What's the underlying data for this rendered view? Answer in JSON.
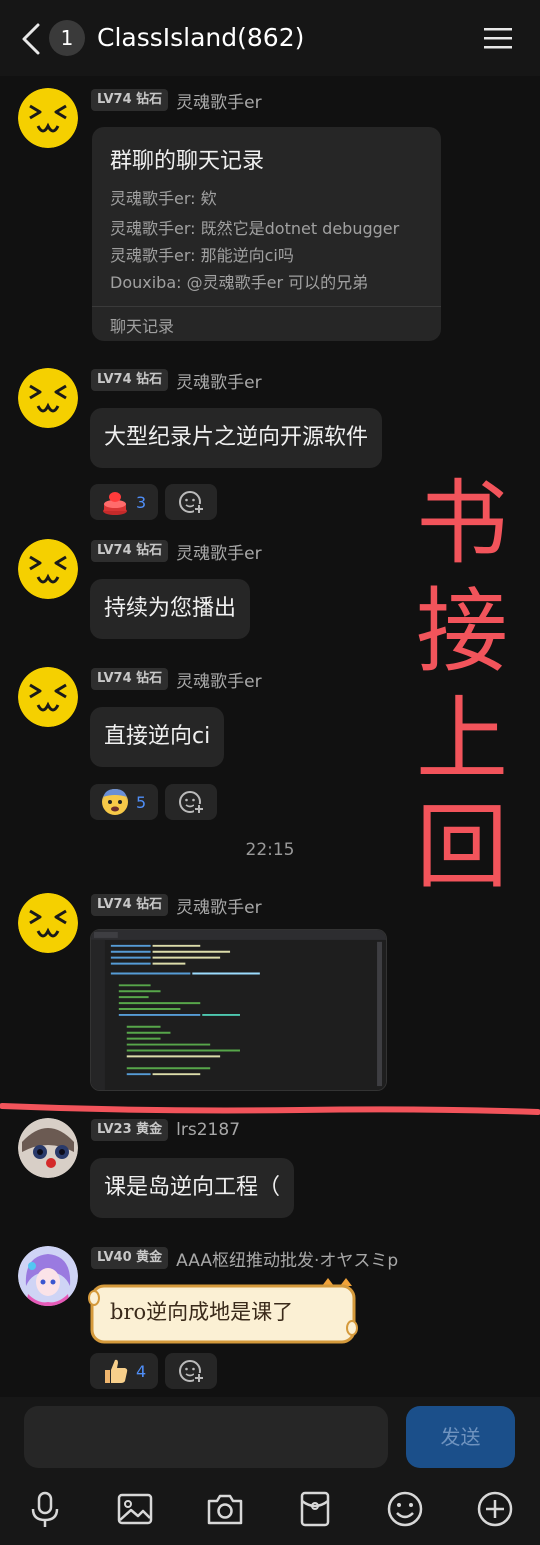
{
  "header": {
    "unread_count": "1",
    "title": "ClassIsland(862)"
  },
  "messages": {
    "m1": {
      "level": "LV74 钻石",
      "sender": "灵魂歌手er",
      "forward": {
        "title": "群聊的聊天记录",
        "lines": [
          "灵魂歌手er: 欸",
          "灵魂歌手er: 既然它是dotnet debugger",
          "灵魂歌手er: 那能逆向ci吗",
          "Douxiba: @灵魂歌手er 可以的兄弟"
        ],
        "footer": "聊天记录"
      }
    },
    "m2": {
      "level": "LV74 钻石",
      "sender": "灵魂歌手er",
      "text": "大型纪录片之逆向开源软件",
      "reaction_count": "3",
      "reaction_icon": "red-alarm-button-icon"
    },
    "m3": {
      "level": "LV74 钻石",
      "sender": "灵魂歌手er",
      "text": "持续为您播出"
    },
    "m4": {
      "level": "LV74 钻石",
      "sender": "灵魂歌手er",
      "text": "直接逆向ci",
      "reaction_count": "5",
      "reaction_icon": "anxious-face-icon"
    },
    "time": "22:15",
    "m5": {
      "level": "LV74 钻石",
      "sender": "灵魂歌手er"
    },
    "m6": {
      "level": "LV23 黄金",
      "sender": "lrs2187",
      "text": "课是岛逆向工程（"
    },
    "m7": {
      "level": "LV40 黄金",
      "sender": "AAA枢纽推动批发·オヤスミp",
      "sticker_text": "bro逆向成地是课了",
      "reaction_count": "4",
      "reaction_icon": "thumbs-up-icon"
    }
  },
  "overlay_text": "书接上回",
  "input": {
    "placeholder": "",
    "send_label": "发送"
  },
  "colors": {
    "background": "#111111",
    "bubble": "#262626",
    "accent": "#4f8ef7",
    "overlay": "#f2545b",
    "send": "#1b4f8a"
  }
}
